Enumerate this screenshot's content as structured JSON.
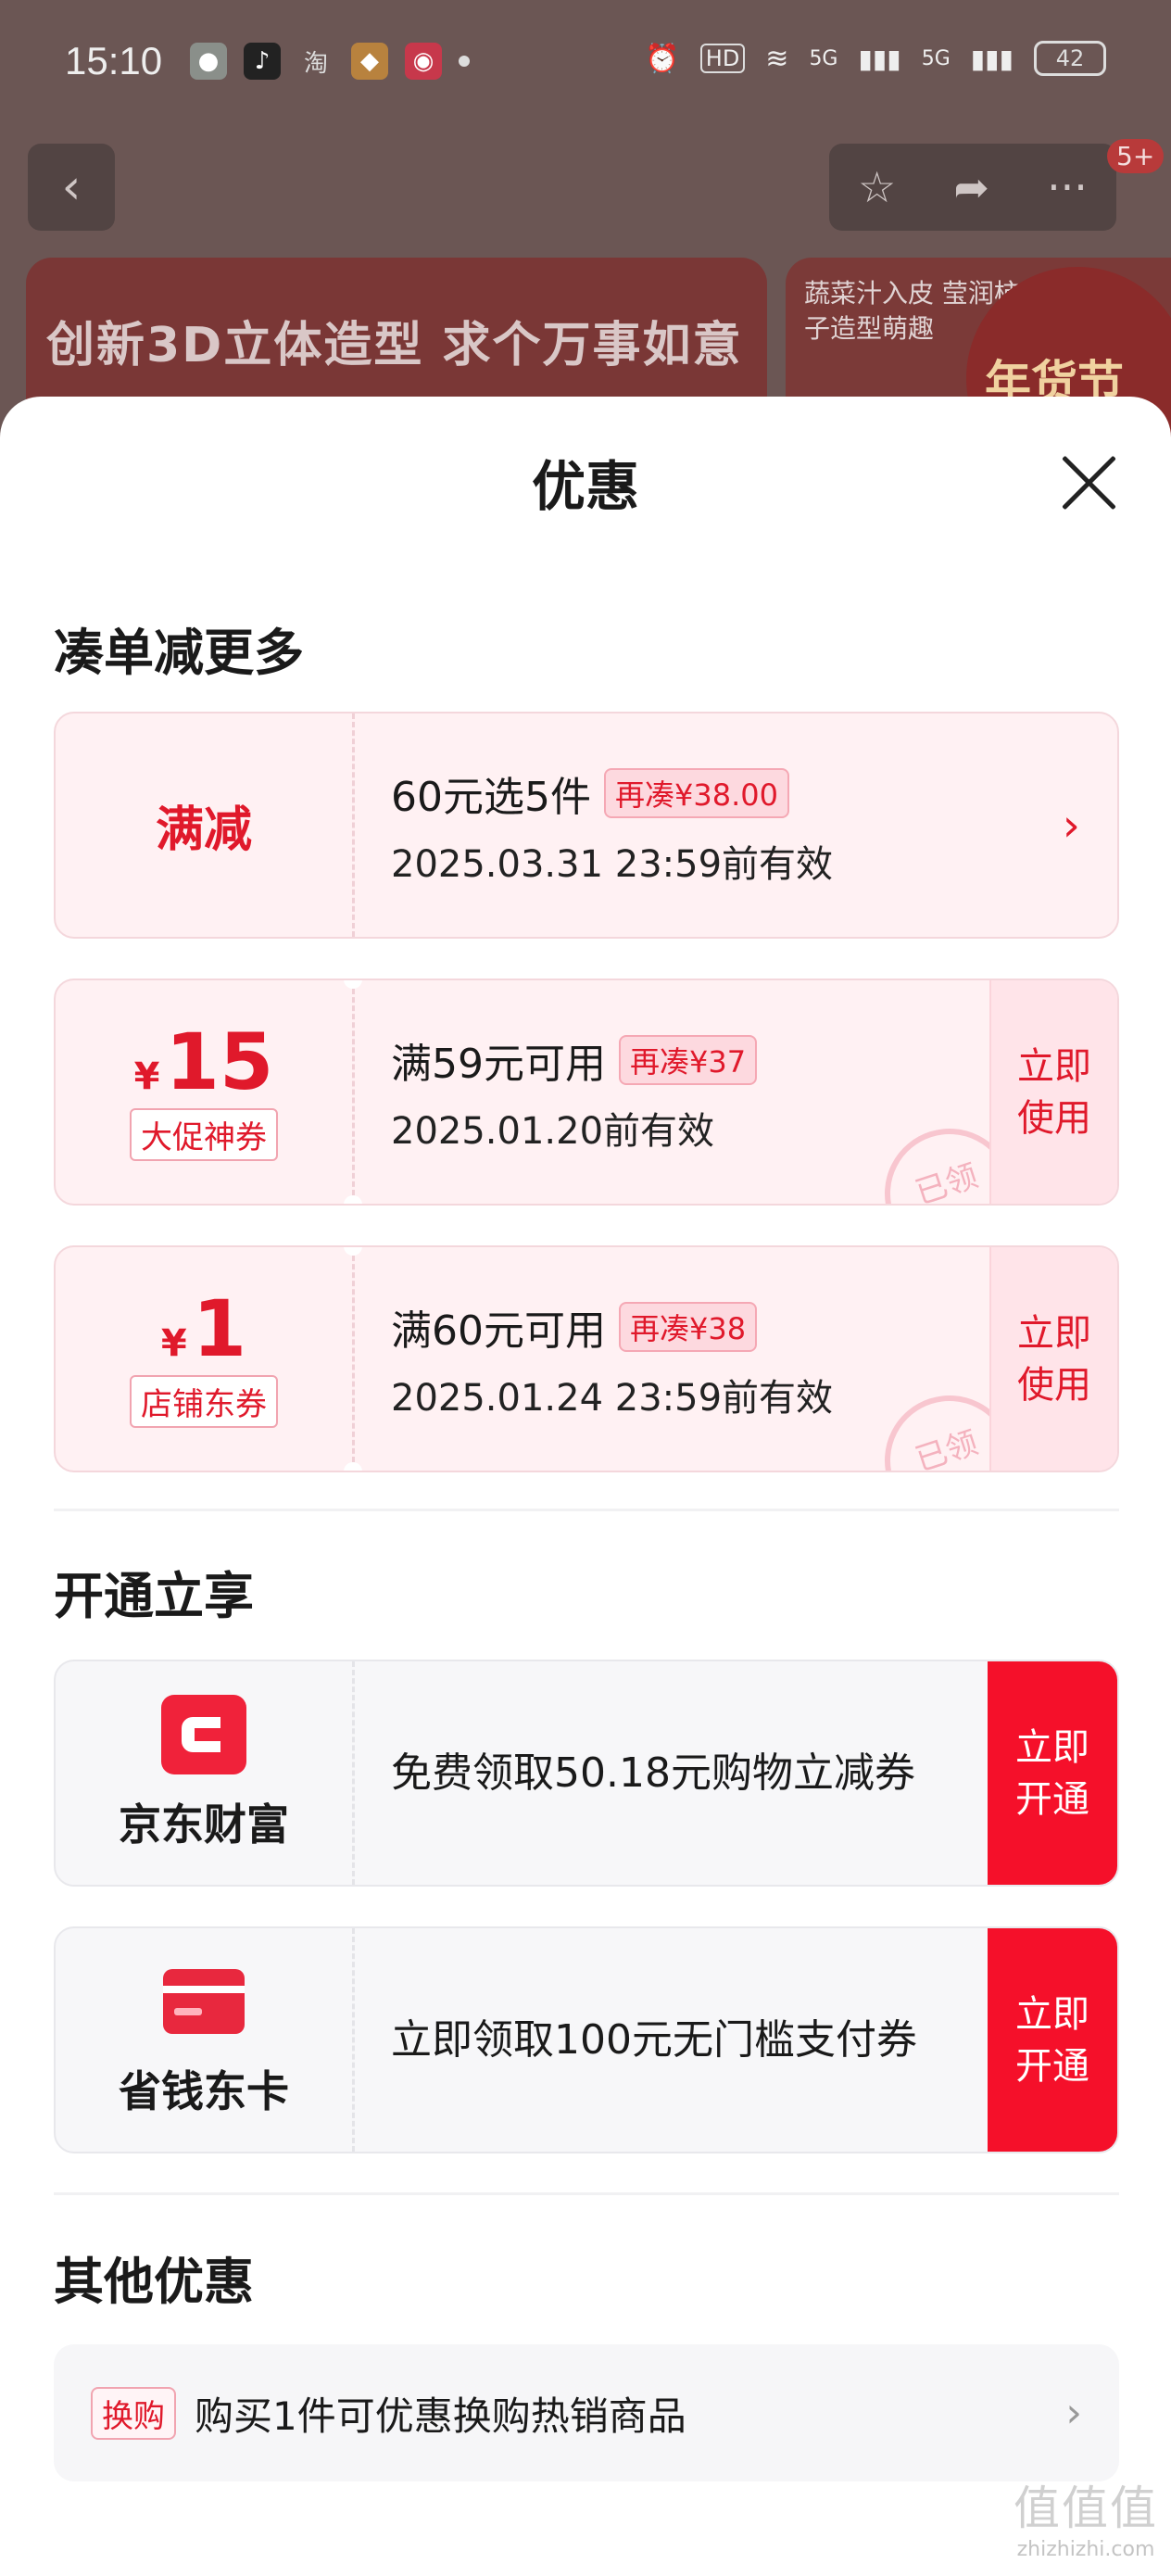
{
  "status_bar": {
    "time": "15:10",
    "app_taobao": "淘",
    "network_hd": "HD",
    "network_5g_1": "5G",
    "network_5g_2": "5G",
    "battery": "42"
  },
  "background": {
    "nav_badge": "5+",
    "banner_1_text": "创新3D立体造型  求个万事如意",
    "banner_2_text": "蔬菜汁入皮 莹润柿子造型萌趣",
    "banner_2_festival": "年货节"
  },
  "sheet": {
    "title": "优惠"
  },
  "section_bundle": {
    "title": "凑单减更多",
    "promo_card": {
      "label": "满减",
      "main": "60元选5件",
      "tag": "再凑¥38.00",
      "validity": "2025.03.31 23:59前有效"
    },
    "coupons": [
      {
        "currency": "¥",
        "amount": "15",
        "type": "大促神券",
        "main": "满59元可用",
        "tag": "再凑¥37",
        "validity": "2025.01.20前有效",
        "action": "立即使用",
        "stamp": "已领"
      },
      {
        "currency": "¥",
        "amount": "1",
        "type": "店铺东券",
        "main": "满60元可用",
        "tag": "再凑¥38",
        "validity": "2025.01.24 23:59前有效",
        "action": "立即使用",
        "stamp": "已领"
      }
    ]
  },
  "section_open": {
    "title": "开通立享",
    "items": [
      {
        "name": "京东财富",
        "desc": "免费领取50.18元购物立减券",
        "action": "立即开通",
        "icon_color": "#f0223a"
      },
      {
        "name": "省钱东卡",
        "desc": "立即领取100元无门槛支付券",
        "action": "立即开通",
        "icon_color": "#e8283e"
      }
    ]
  },
  "section_other": {
    "title": "其他优惠",
    "row": {
      "tag": "换购",
      "text": "购买1件可优惠换购热销商品"
    }
  },
  "watermark": {
    "big": "值值值",
    "small": "zhizhizhi.com"
  },
  "colors": {
    "accent": "#e0192b",
    "open_button": "#f5102a",
    "coupon_bg": "#fff1f3"
  }
}
